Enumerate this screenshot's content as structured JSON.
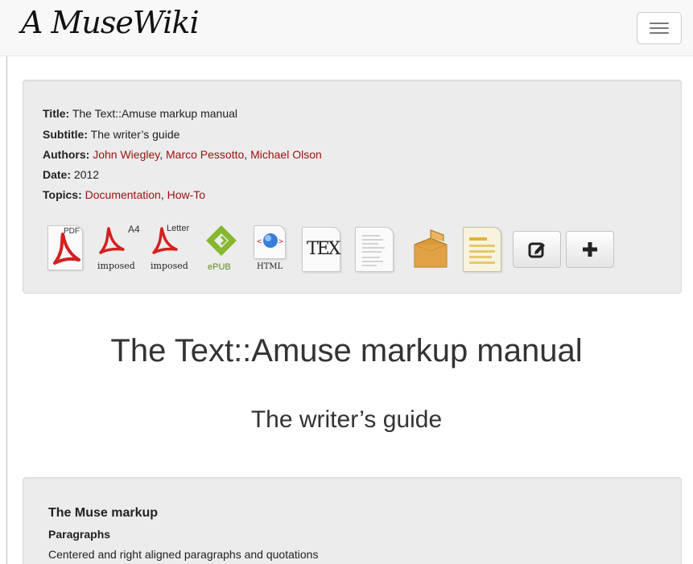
{
  "site": {
    "brand": "A MuseWiki"
  },
  "metadata": {
    "title_label": "Title:",
    "title": "The Text::Amuse markup manual",
    "subtitle_label": "Subtitle:",
    "subtitle": "The writer’s guide",
    "authors_label": "Authors:",
    "authors": [
      "John Wiegley",
      "Marco Pessotto",
      "Michael Olson"
    ],
    "date_label": "Date:",
    "date": "2012",
    "topics_label": "Topics:",
    "topics": [
      "Documentation",
      "How-To"
    ],
    "separator": ", "
  },
  "downloads": {
    "pdf": {
      "icon": "pdf-icon",
      "tag": "PDF"
    },
    "a4": {
      "icon": "pdf-a4-imposed-icon",
      "tag": "A4",
      "caption": "imposed"
    },
    "letter": {
      "icon": "pdf-letter-imposed-icon",
      "tag": "Letter",
      "caption": "imposed"
    },
    "epub": {
      "icon": "epub-icon",
      "caption": "ePUB"
    },
    "html": {
      "icon": "html-icon",
      "caption": "HTML"
    },
    "tex": {
      "icon": "tex-icon",
      "tag": "TEX"
    },
    "plain": {
      "icon": "plain-text-icon"
    },
    "zip": {
      "icon": "zip-archive-icon"
    },
    "odt": {
      "icon": "odt-icon"
    },
    "edit": {
      "icon": "edit-icon"
    },
    "add": {
      "icon": "plus-icon"
    }
  },
  "heading": {
    "title": "The Text::Amuse markup manual",
    "subtitle": "The writer’s guide"
  },
  "toc": {
    "h1": "The Muse markup",
    "h2": "Paragraphs",
    "item": "Centered and right aligned paragraphs and quotations"
  },
  "colors": {
    "link": "#9b1010",
    "well": "#ececec",
    "epub_green": "#85b82e",
    "pdf_red": "#d42020"
  }
}
